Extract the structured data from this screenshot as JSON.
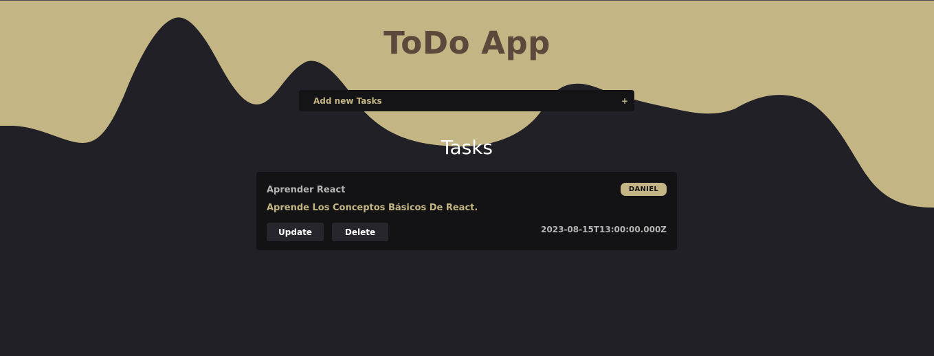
{
  "colors": {
    "background": "#212026",
    "wave": "#c4b584",
    "title": "#5b4a3c",
    "card": "#131315",
    "accent": "#c4b584",
    "button": "#27262c"
  },
  "header": {
    "title": "ToDo App"
  },
  "add_task": {
    "label": "Add new Tasks",
    "icon": "plus-icon",
    "icon_glyph": "+"
  },
  "tasks_section": {
    "title": "Tasks"
  },
  "tasks": [
    {
      "title": "Aprender React",
      "author": "DANIEL",
      "description": "Aprende Los Conceptos Básicos De React.",
      "update_label": "Update",
      "delete_label": "Delete",
      "date": "2023-08-15T13:00:00.000Z"
    }
  ]
}
